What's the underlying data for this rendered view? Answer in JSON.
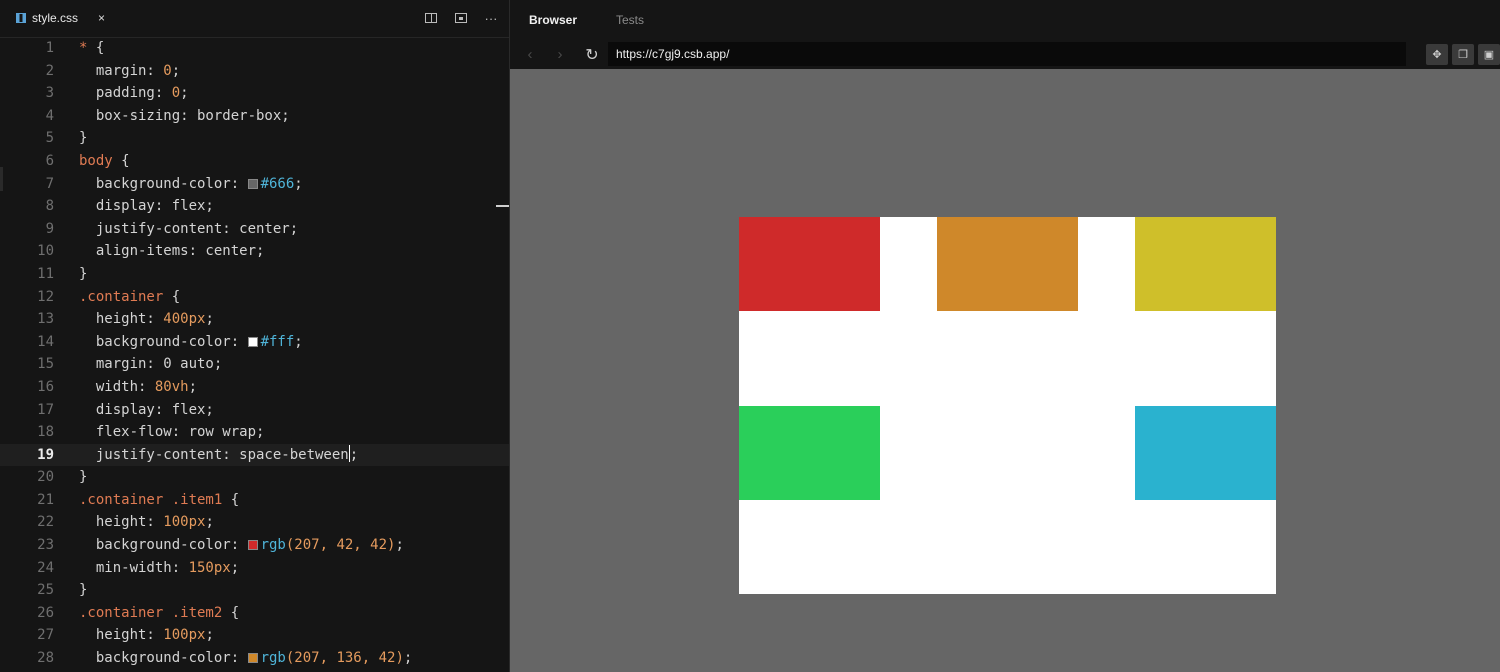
{
  "editor": {
    "tab": {
      "filename": "style.css",
      "close": "×"
    },
    "actions": [
      "split-editor",
      "open-preview",
      "more"
    ],
    "more_label": "···",
    "active_line": 19,
    "lines": [
      {
        "n": "1"
      },
      {
        "n": "2"
      },
      {
        "n": "3"
      },
      {
        "n": "4"
      },
      {
        "n": "5"
      },
      {
        "n": "6"
      },
      {
        "n": "7"
      },
      {
        "n": "8"
      },
      {
        "n": "9"
      },
      {
        "n": "10"
      },
      {
        "n": "11"
      },
      {
        "n": "12"
      },
      {
        "n": "13"
      },
      {
        "n": "14"
      },
      {
        "n": "15"
      },
      {
        "n": "16"
      },
      {
        "n": "17"
      },
      {
        "n": "18"
      },
      {
        "n": "19"
      },
      {
        "n": "20"
      },
      {
        "n": "21"
      },
      {
        "n": "22"
      },
      {
        "n": "23"
      },
      {
        "n": "24"
      },
      {
        "n": "25"
      },
      {
        "n": "26"
      },
      {
        "n": "27"
      },
      {
        "n": "28"
      }
    ],
    "code": {
      "l1_sel": "*",
      "l1_rest": " {",
      "l2_prop": "  margin: ",
      "l2_val": "0",
      "l2_end": ";",
      "l3_prop": "  padding: ",
      "l3_val": "0",
      "l3_end": ";",
      "l4": "  box-sizing: border-box;",
      "l5": "}",
      "l6_sel": "body",
      "l6_rest": " {",
      "l7_prop": "  background-color: ",
      "l7_val": "#666",
      "l7_end": ";",
      "l8": "  display: flex;",
      "l9": "  justify-content: center;",
      "l10": "  align-items: center;",
      "l11": "}",
      "l12_sel": ".container",
      "l12_rest": " {",
      "l13_prop": "  height: ",
      "l13_val": "400px",
      "l13_end": ";",
      "l14_prop": "  background-color: ",
      "l14_val": "#fff",
      "l14_end": ";",
      "l15": "  margin: 0 auto;",
      "l16_prop": "  width: ",
      "l16_val": "80vh",
      "l16_end": ";",
      "l17": "  display: flex;",
      "l18": "  flex-flow: row wrap;",
      "l19": "  justify-content: space-between",
      "l19_end": ";",
      "l20": "}",
      "l21_sel": ".container .item1",
      "l21_rest": " {",
      "l22_prop": "  height: ",
      "l22_val": "100px",
      "l22_end": ";",
      "l23_prop": "  background-color: ",
      "l23_fn": "rgb",
      "l23_args": "(207, 42, 42)",
      "l23_end": ";",
      "l24_prop": "  min-width: ",
      "l24_val": "150px",
      "l24_end": ";",
      "l25": "}",
      "l26_sel": ".container .item2",
      "l26_rest": " {",
      "l27_prop": "  height: ",
      "l27_val": "100px",
      "l27_end": ";",
      "l28_prop": "  background-color: ",
      "l28_fn": "rgb",
      "l28_args": "(207, 136, 42)",
      "l28_end": ";"
    },
    "swatches": {
      "l7": "#666666",
      "l14": "#ffffff",
      "l23": "#cf2a2a",
      "l28": "#cf882a"
    }
  },
  "browser": {
    "tabs": [
      "Browser",
      "Tests"
    ],
    "active_tab": "Browser",
    "url": "https://c7gj9.csb.app/",
    "nav": {
      "back": "‹",
      "forward": "›",
      "reload": "↻"
    },
    "viewport_bg": "#666666",
    "container_bg": "#ffffff",
    "items": [
      {
        "name": "item1",
        "color": "#cf2a2a"
      },
      {
        "name": "item2",
        "color": "#cf882a"
      },
      {
        "name": "item3",
        "color": "#cfbf2a"
      },
      {
        "name": "item4",
        "color": "#2acf5a"
      },
      {
        "name": "item5",
        "color": "#2ab2cf"
      }
    ]
  }
}
